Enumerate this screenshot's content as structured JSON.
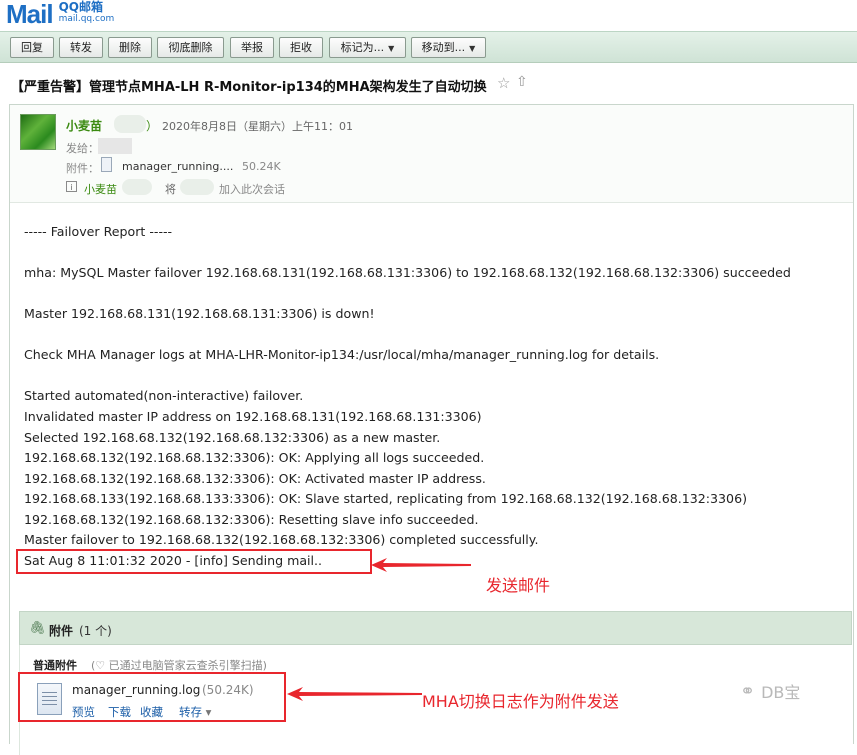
{
  "logo": {
    "mail": "Mail",
    "qq": "QQ邮箱",
    "url": "mail.qq.com"
  },
  "toolbar": {
    "reply": "回复",
    "forward": "转发",
    "delete": "删除",
    "delete_permanent": "彻底删除",
    "report": "举报",
    "reject": "拒收",
    "mark_as": "标记为...",
    "move_to": "移动到..."
  },
  "subject": "【严重告警】管理节点MHA-LH R-Monitor-ip134的MHA架构发生了自动切换",
  "header": {
    "sender": "小麦苗",
    "paren_close": "）",
    "datetime": "2020年8月8日（星期六）上午11：01",
    "to_label": "发给：",
    "attachment_label": "附件：",
    "attachment_name": "manager_running....",
    "attachment_size": "50.24K",
    "info_sender": "小麦苗",
    "info_text1": "将",
    "info_text2": "加入此次会话"
  },
  "body_lines": [
    "----- Failover Report -----",
    "mha: MySQL Master failover 192.168.68.131(192.168.68.131:3306) to 192.168.68.132(192.168.68.132:3306) succeeded",
    "Master 192.168.68.131(192.168.68.131:3306) is down!",
    "Check MHA Manager logs at MHA-LHR-Monitor-ip134:/usr/local/mha/manager_running.log for details.",
    "Started automated(non-interactive) failover.",
    "Invalidated master IP address on 192.168.68.131(192.168.68.131:3306)",
    "Selected 192.168.68.132(192.168.68.132:3306) as a new master.",
    "192.168.68.132(192.168.68.132:3306): OK: Applying all logs succeeded.",
    "192.168.68.132(192.168.68.132:3306): OK: Activated master IP address.",
    "192.168.68.133(192.168.68.133:3306): OK: Slave started, replicating from 192.168.68.132(192.168.68.132:3306)",
    "192.168.68.132(192.168.68.132:3306): Resetting slave info succeeded.",
    "Master failover to 192.168.68.132(192.168.68.132:3306) completed successfully.",
    "Sat Aug  8 11:01:32 2020 - [info] Sending mail.."
  ],
  "annotations": {
    "send_mail": "发送邮件",
    "attach_log": "MHA切换日志作为附件发送"
  },
  "attachments": {
    "title": "附件",
    "count": "(1 个)",
    "normal": "普通附件",
    "scan_note": "(♡ 已通过电脑管家云查杀引擎扫描)",
    "file_name": "manager_running.log",
    "file_size": "(50.24K)",
    "preview": "预览",
    "download": "下载",
    "favorite": "收藏",
    "save_to": "转存",
    "save_caret": "▾"
  },
  "watermark": {
    "text": "DB宝"
  }
}
